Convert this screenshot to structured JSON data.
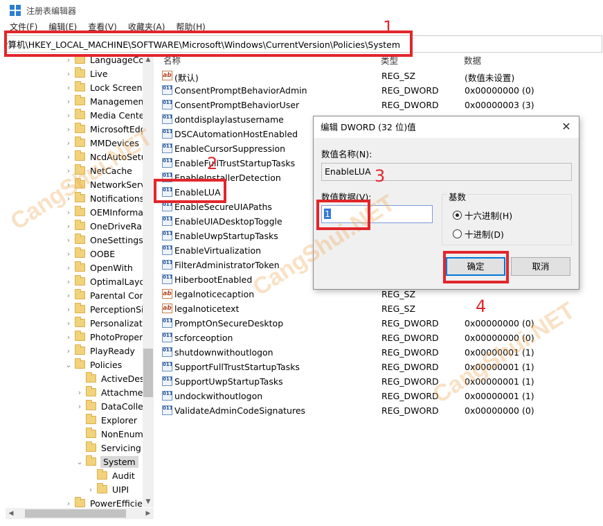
{
  "window": {
    "title": "注册表编辑器"
  },
  "menu": [
    "文件(F)",
    "编辑(E)",
    "查看(V)",
    "收藏夹(A)",
    "帮助(H)"
  ],
  "address": "计算机\\HKEY_LOCAL_MACHINE\\SOFTWARE\\Microsoft\\Windows\\CurrentVersion\\Policies\\System",
  "tree": [
    {
      "label": "LanguageComponentsInstaller",
      "arrow": ">",
      "level": 0
    },
    {
      "label": "Live",
      "arrow": ">",
      "level": 0
    },
    {
      "label": "Lock Screen",
      "arrow": ">",
      "level": 0
    },
    {
      "label": "Management Infrastructure",
      "arrow": ">",
      "level": 0
    },
    {
      "label": "Media Center",
      "arrow": ">",
      "level": 0
    },
    {
      "label": "MicrosoftEdge",
      "arrow": ">",
      "level": 0
    },
    {
      "label": "MMDevices",
      "arrow": ">",
      "level": 0
    },
    {
      "label": "NcdAutoSetup",
      "arrow": ">",
      "level": 0
    },
    {
      "label": "NetCache",
      "arrow": ">",
      "level": 0
    },
    {
      "label": "NetworkServiceTriggers",
      "arrow": ">",
      "level": 0
    },
    {
      "label": "Notifications",
      "arrow": ">",
      "level": 0
    },
    {
      "label": "OEMInformation",
      "arrow": ">",
      "level": 0
    },
    {
      "label": "OneDriveRamps",
      "arrow": ">",
      "level": 0
    },
    {
      "label": "OneSettings",
      "arrow": ">",
      "level": 0
    },
    {
      "label": "OOBE",
      "arrow": ">",
      "level": 0
    },
    {
      "label": "OpenWith",
      "arrow": ">",
      "level": 0
    },
    {
      "label": "OptimalLayout",
      "arrow": ">",
      "level": 0
    },
    {
      "label": "Parental Controls",
      "arrow": ">",
      "level": 0
    },
    {
      "label": "PerceptionSimulationExtensions",
      "arrow": ">",
      "level": 0
    },
    {
      "label": "Personalization",
      "arrow": ">",
      "level": 0
    },
    {
      "label": "PhotoPropertyHandler",
      "arrow": ">",
      "level": 0
    },
    {
      "label": "PlayReady",
      "arrow": ">",
      "level": 0
    },
    {
      "label": "Policies",
      "arrow": "v",
      "level": 0
    },
    {
      "label": "ActiveDesktop",
      "arrow": "",
      "level": 1
    },
    {
      "label": "Attachments",
      "arrow": ">",
      "level": 1
    },
    {
      "label": "DataCollection",
      "arrow": ">",
      "level": 1
    },
    {
      "label": "Explorer",
      "arrow": "",
      "level": 1
    },
    {
      "label": "NonEnum",
      "arrow": "",
      "level": 1
    },
    {
      "label": "Servicing",
      "arrow": "",
      "level": 1
    },
    {
      "label": "System",
      "arrow": "v",
      "level": 1,
      "selected": true
    },
    {
      "label": "Audit",
      "arrow": "",
      "level": 2
    },
    {
      "label": "UIPI",
      "arrow": ">",
      "level": 2
    },
    {
      "label": "PowerEfficiencyDiagnostics",
      "arrow": ">",
      "level": 0
    }
  ],
  "columns": {
    "name": "名称",
    "type": "类型",
    "data": "数据"
  },
  "values": [
    {
      "name": "(默认)",
      "type": "REG_SZ",
      "data": "(数值未设置)",
      "icon": "ab"
    },
    {
      "name": "ConsentPromptBehaviorAdmin",
      "type": "REG_DWORD",
      "data": "0x00000000 (0)",
      "icon": "bin"
    },
    {
      "name": "ConsentPromptBehaviorUser",
      "type": "REG_DWORD",
      "data": "0x00000003 (3)",
      "icon": "bin"
    },
    {
      "name": "dontdisplaylastusername",
      "type": "",
      "data": "",
      "icon": "bin"
    },
    {
      "name": "DSCAutomationHostEnabled",
      "type": "",
      "data": "",
      "icon": "bin"
    },
    {
      "name": "EnableCursorSuppression",
      "type": "",
      "data": "",
      "icon": "bin"
    },
    {
      "name": "EnableFullTrustStartupTasks",
      "type": "",
      "data": "",
      "icon": "bin"
    },
    {
      "name": "EnableInstallerDetection",
      "type": "",
      "data": "",
      "icon": "bin"
    },
    {
      "name": "EnableLUA",
      "type": "",
      "data": "",
      "icon": "bin"
    },
    {
      "name": "EnableSecureUIAPaths",
      "type": "",
      "data": "",
      "icon": "bin"
    },
    {
      "name": "EnableUIADesktopToggle",
      "type": "",
      "data": "",
      "icon": "bin"
    },
    {
      "name": "EnableUwpStartupTasks",
      "type": "",
      "data": "",
      "icon": "bin"
    },
    {
      "name": "EnableVirtualization",
      "type": "",
      "data": "",
      "icon": "bin"
    },
    {
      "name": "FilterAdministratorToken",
      "type": "",
      "data": "",
      "icon": "bin"
    },
    {
      "name": "HiberbootEnabled",
      "type": "",
      "data": "",
      "icon": "bin"
    },
    {
      "name": "legalnoticecaption",
      "type": "REG_SZ",
      "data": "",
      "icon": "ab"
    },
    {
      "name": "legalnoticetext",
      "type": "REG_SZ",
      "data": "",
      "icon": "ab"
    },
    {
      "name": "PromptOnSecureDesktop",
      "type": "REG_DWORD",
      "data": "0x00000000 (0)",
      "icon": "bin"
    },
    {
      "name": "scforceoption",
      "type": "REG_DWORD",
      "data": "0x00000000 (0)",
      "icon": "bin"
    },
    {
      "name": "shutdownwithoutlogon",
      "type": "REG_DWORD",
      "data": "0x00000001 (1)",
      "icon": "bin"
    },
    {
      "name": "SupportFullTrustStartupTasks",
      "type": "REG_DWORD",
      "data": "0x00000001 (1)",
      "icon": "bin"
    },
    {
      "name": "SupportUwpStartupTasks",
      "type": "REG_DWORD",
      "data": "0x00000001 (1)",
      "icon": "bin"
    },
    {
      "name": "undockwithoutlogon",
      "type": "REG_DWORD",
      "data": "0x00000001 (1)",
      "icon": "bin"
    },
    {
      "name": "ValidateAdminCodeSignatures",
      "type": "REG_DWORD",
      "data": "0x00000000 (0)",
      "icon": "bin"
    }
  ],
  "dialog": {
    "title": "编辑 DWORD (32 位)值",
    "close": "✕",
    "name_label": "数值名称(N):",
    "name_value": "EnableLUA",
    "data_label": "数值数据(V):",
    "data_value": "1",
    "base_label": "基数",
    "hex_label": "十六进制(H)",
    "dec_label": "十进制(D)",
    "hex_checked": true,
    "ok": "确定",
    "cancel": "取消"
  },
  "annotations": [
    "1",
    "2",
    "3",
    "4"
  ],
  "watermark": "CangShui.NET",
  "colors": {
    "annotation": "#e2262b",
    "selection": "#3079d7",
    "ok_border": "#0078d7"
  }
}
